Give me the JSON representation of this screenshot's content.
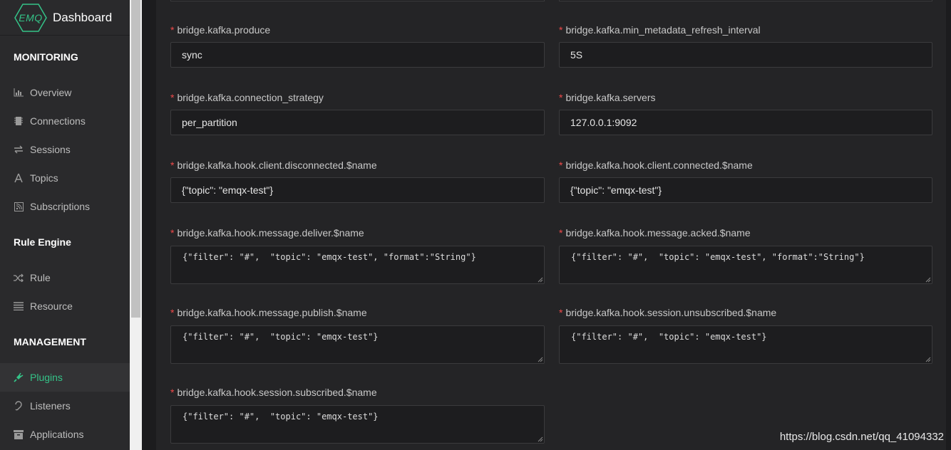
{
  "brand": {
    "logo_text": "EMQ",
    "title": "Dashboard"
  },
  "colors": {
    "accent": "#34c388",
    "required": "#f04a4a"
  },
  "sidebar": {
    "sections": [
      {
        "title": "MONITORING",
        "items": [
          {
            "label": "Overview",
            "icon": "bar-chart-icon"
          },
          {
            "label": "Connections",
            "icon": "chip-icon"
          },
          {
            "label": "Sessions",
            "icon": "swap-arrows-icon"
          },
          {
            "label": "Topics",
            "icon": "topics-icon"
          },
          {
            "label": "Subscriptions",
            "icon": "rss-icon"
          }
        ]
      },
      {
        "title": "Rule Engine",
        "items": [
          {
            "label": "Rule",
            "icon": "shuffle-icon"
          },
          {
            "label": "Resource",
            "icon": "list-icon"
          }
        ]
      },
      {
        "title": "MANAGEMENT",
        "items": [
          {
            "label": "Plugins",
            "icon": "plug-icon",
            "active": true
          },
          {
            "label": "Listeners",
            "icon": "ear-icon"
          },
          {
            "label": "Applications",
            "icon": "app-icon"
          }
        ]
      }
    ]
  },
  "form": {
    "fields": [
      {
        "label": "bridge.kafka.produce",
        "value": "sync",
        "type": "input"
      },
      {
        "label": "bridge.kafka.min_metadata_refresh_interval",
        "value": "5S",
        "type": "input"
      },
      {
        "label": "bridge.kafka.connection_strategy",
        "value": "per_partition",
        "type": "input"
      },
      {
        "label": "bridge.kafka.servers",
        "value": "127.0.0.1:9092",
        "type": "input"
      },
      {
        "label": "bridge.kafka.hook.client.disconnected.$name",
        "value": "{\"topic\": \"emqx-test\"}",
        "type": "input"
      },
      {
        "label": "bridge.kafka.hook.client.connected.$name",
        "value": "{\"topic\": \"emqx-test\"}",
        "type": "input"
      },
      {
        "label": "bridge.kafka.hook.message.deliver.$name",
        "value": "{\"filter\": \"#\",  \"topic\": \"emqx-test\", \"format\":\"String\"}",
        "type": "textarea"
      },
      {
        "label": "bridge.kafka.hook.message.acked.$name",
        "value": "{\"filter\": \"#\",  \"topic\": \"emqx-test\", \"format\":\"String\"}",
        "type": "textarea"
      },
      {
        "label": "bridge.kafka.hook.message.publish.$name",
        "value": "{\"filter\": \"#\",  \"topic\": \"emqx-test\"}",
        "type": "textarea"
      },
      {
        "label": "bridge.kafka.hook.session.unsubscribed.$name",
        "value": "{\"filter\": \"#\",  \"topic\": \"emqx-test\"}",
        "type": "textarea"
      },
      {
        "label": "bridge.kafka.hook.session.subscribed.$name",
        "value": "{\"filter\": \"#\",  \"topic\": \"emqx-test\"}",
        "type": "textarea"
      }
    ]
  },
  "watermark": "https://blog.csdn.net/qq_41094332"
}
